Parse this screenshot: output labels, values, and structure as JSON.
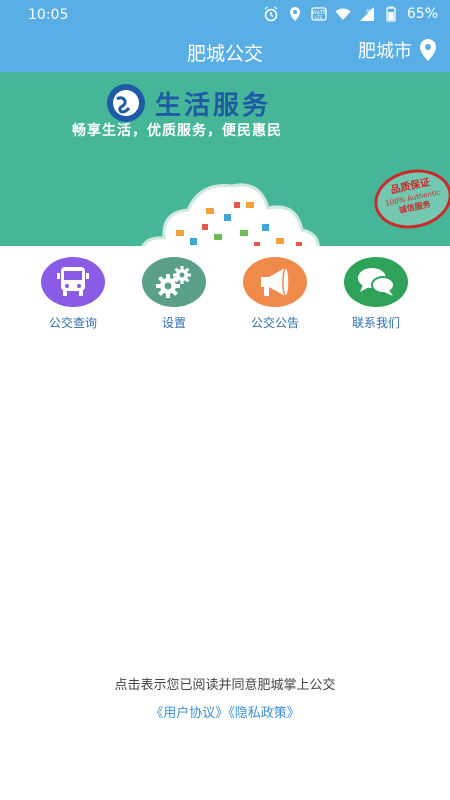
{
  "status_bar": {
    "time": "10:05",
    "battery": "65%",
    "icons": [
      "alarm-icon",
      "location-icon",
      "volte-icon",
      "wifi-icon",
      "signal-4g-icon",
      "battery-icon"
    ]
  },
  "app_bar": {
    "title": "肥城公交",
    "city": "肥城市",
    "bg_color": "#5aaee6"
  },
  "banner": {
    "heading": "生活服务",
    "subheading": "畅享生活，优质服务，便民惠民",
    "stamp_lines": [
      "品质保证",
      "100% Authentic",
      "诚信服务"
    ],
    "bg_color": "#46b698"
  },
  "nav": [
    {
      "label": "公交查询",
      "icon": "bus-icon",
      "color": "#8a5ce6"
    },
    {
      "label": "设置",
      "icon": "gear-icon",
      "color": "#5aa088"
    },
    {
      "label": "公交公告",
      "icon": "megaphone-icon",
      "color": "#f08a4b"
    },
    {
      "label": "联系我们",
      "icon": "chat-icon",
      "color": "#2fa35a"
    }
  ],
  "footer": {
    "agreement_text": "点击表示您已阅读并同意肥城掌上公交",
    "user_agreement": "《用户协议》",
    "privacy_policy": "《隐私政策》"
  }
}
